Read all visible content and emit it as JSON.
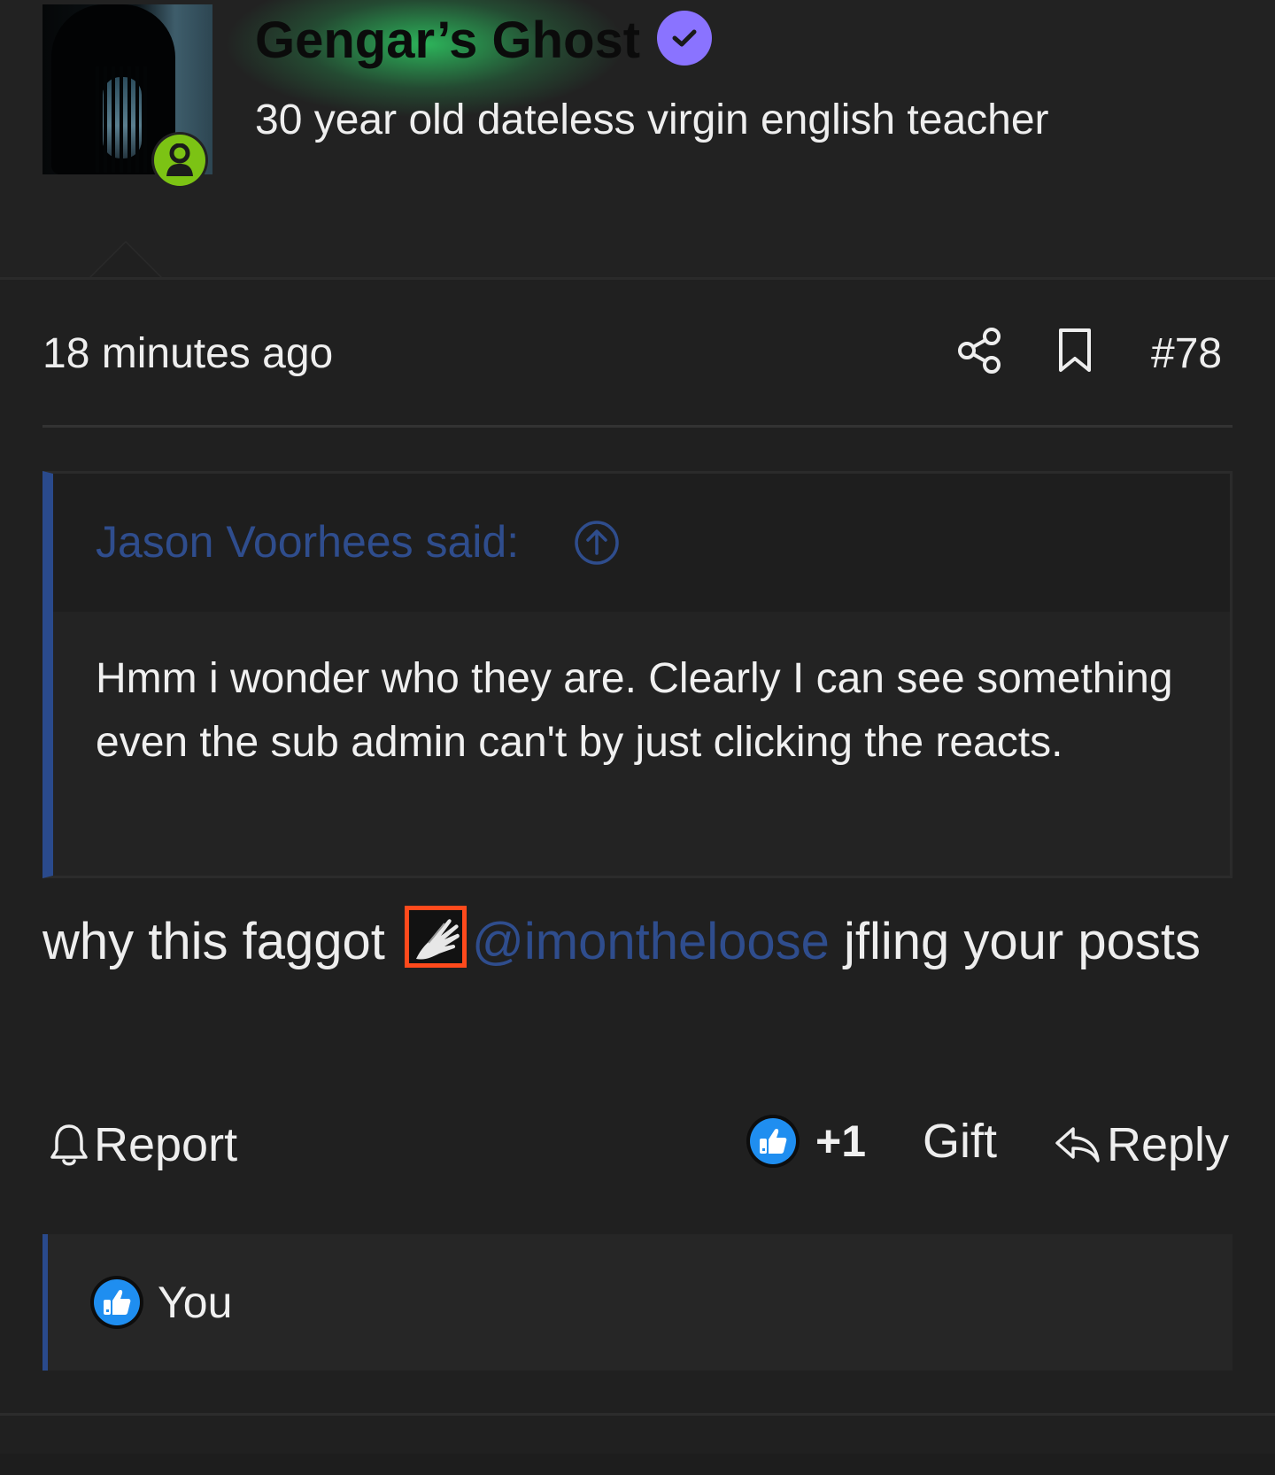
{
  "author": {
    "name": "Gengar’s Ghost",
    "title": "30 year old dateless virgin english teacher",
    "verified": true,
    "online": true,
    "name_glow_color": "#2ecd64",
    "verified_color": "#8a73ff",
    "online_color": "#7cc314"
  },
  "meta": {
    "timestamp": "18 minutes ago",
    "post_number": "#78",
    "icons": [
      "share-icon",
      "bookmark-icon"
    ]
  },
  "quote": {
    "author_label": "Jason Voorhees said:",
    "text": "Hmm i wonder who they are. Clearly I can see something even the sub admin can't by just clicking the reacts.",
    "accent_color": "#2a4a8c"
  },
  "message": {
    "before": "why this faggot ",
    "mention": "@imontheloose",
    "after": " jfling your posts",
    "mention_color": "#2f4d8d"
  },
  "actions": {
    "report_label": "Report",
    "reaction_count": "+1",
    "gift_label": "Gift",
    "reply_label": "Reply",
    "like_color": "#1f8ef0"
  },
  "reactions": {
    "users": [
      "You"
    ]
  }
}
